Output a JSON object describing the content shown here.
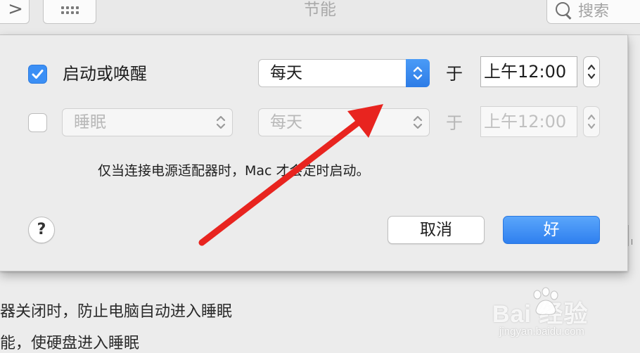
{
  "window": {
    "title": "节能"
  },
  "toolbar": {
    "forward_glyph": ">",
    "search_placeholder": "搜索",
    "icons": [
      "forward-chevron-icon",
      "show-all-grid-icon",
      "search-icon"
    ]
  },
  "schedule": {
    "wake": {
      "checked": true,
      "label": "启动或唤醒",
      "frequency": "每天",
      "at_label": "于",
      "time": "上午12:00"
    },
    "sleep": {
      "checked": false,
      "action": "睡眠",
      "frequency": "每天",
      "at_label": "于",
      "time": "上午12:00"
    },
    "note": "仅当连接电源适配器时，Mac 才会定时启动。"
  },
  "buttons": {
    "help": "?",
    "cancel": "取消",
    "ok": "好"
  },
  "background_text": {
    "line1": "器关闭时，防止电脑自动进入睡眠",
    "line2": "能，使硬盘进入睡眠"
  },
  "watermark": {
    "logo": "Bai  经验",
    "url": "jingyan.baidu.com"
  },
  "colors": {
    "accent": "#3b8ff5",
    "annotation_arrow": "#e8241f"
  }
}
